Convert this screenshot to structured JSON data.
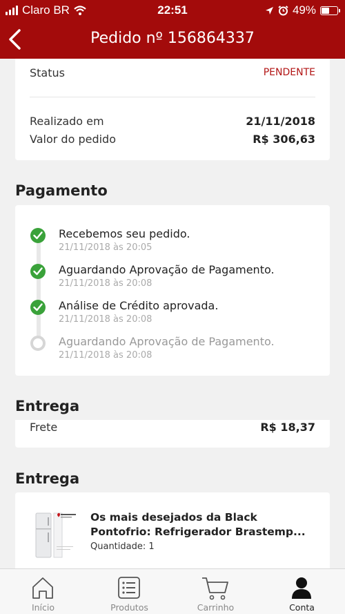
{
  "status_bar": {
    "carrier": "Claro BR",
    "time": "22:51",
    "battery": "49%"
  },
  "header": {
    "title": "Pedido nº 156864337"
  },
  "order": {
    "status_label": "Status",
    "status_value": "PENDENTE",
    "date_label": "Realizado em",
    "date_value": "21/11/2018",
    "total_label": "Valor do pedido",
    "total_value": "R$  306,63"
  },
  "payment": {
    "title": "Pagamento",
    "steps": [
      {
        "title": "Recebemos seu pedido.",
        "date": "21/11/2018 às 20:05",
        "done": true
      },
      {
        "title": "Aguardando Aprovação de Pagamento.",
        "date": "21/11/2018 às 20:08",
        "done": true
      },
      {
        "title": "Análise de Crédito aprovada.",
        "date": "21/11/2018 às 20:08",
        "done": true
      },
      {
        "title": "Aguardando Aprovação de Pagamento.",
        "date": "21/11/2018 às 20:08",
        "done": false
      }
    ]
  },
  "shipping": {
    "title": "Entrega",
    "freight_label": "Frete",
    "freight_value": "R$  18,37"
  },
  "delivery": {
    "title": "Entrega",
    "items": [
      {
        "name": "Os mais desejados da Black Pontofrio: Refrigerador Brastemp...",
        "quantity": "Quantidade: 1"
      }
    ]
  },
  "tabs": [
    {
      "label": "Início",
      "icon": "home-icon"
    },
    {
      "label": "Produtos",
      "icon": "list-icon"
    },
    {
      "label": "Carrinho",
      "icon": "cart-icon"
    },
    {
      "label": "Conta",
      "icon": "user-icon",
      "active": true
    }
  ],
  "colors": {
    "brand": "#a30b0b",
    "status_pending": "#b21414",
    "step_done": "#3aa23a"
  }
}
